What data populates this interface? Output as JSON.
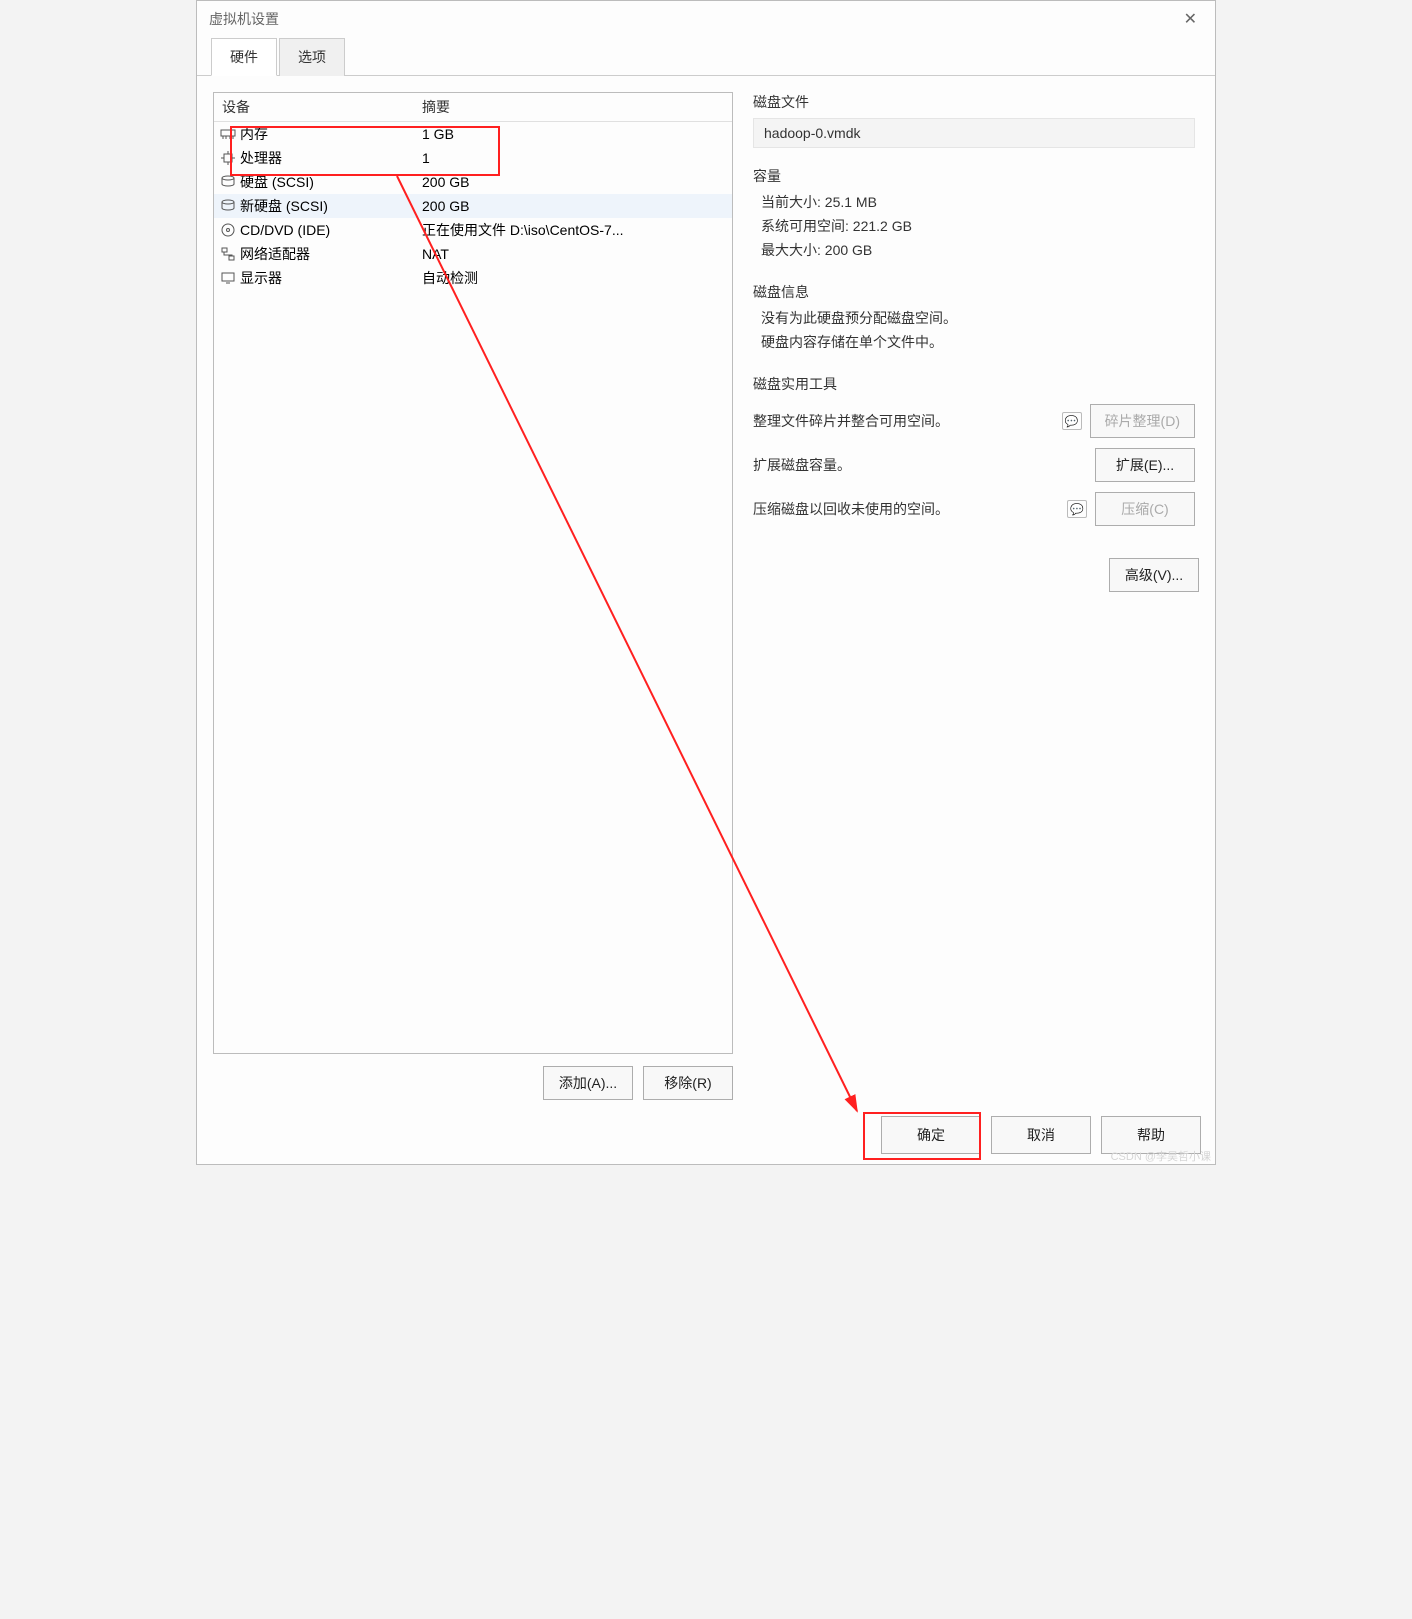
{
  "window": {
    "title": "虚拟机设置"
  },
  "tabs": {
    "hardware": "硬件",
    "options": "选项"
  },
  "device_table": {
    "header_device": "设备",
    "header_summary": "摘要",
    "rows": [
      {
        "icon": "memory",
        "name": "内存",
        "summary": "1 GB"
      },
      {
        "icon": "cpu",
        "name": "处理器",
        "summary": "1"
      },
      {
        "icon": "disk",
        "name": "硬盘 (SCSI)",
        "summary": "200 GB"
      },
      {
        "icon": "disk",
        "name": "新硬盘 (SCSI)",
        "summary": "200 GB"
      },
      {
        "icon": "cd",
        "name": "CD/DVD (IDE)",
        "summary": "正在使用文件 D:\\iso\\CentOS-7..."
      },
      {
        "icon": "net",
        "name": "网络适配器",
        "summary": "NAT"
      },
      {
        "icon": "display",
        "name": "显示器",
        "summary": "自动检测"
      }
    ]
  },
  "left_buttons": {
    "add": "添加(A)...",
    "remove": "移除(R)"
  },
  "right": {
    "disk_file_label": "磁盘文件",
    "disk_file_value": "hadoop-0.vmdk",
    "capacity_label": "容量",
    "current_size": "当前大小: 25.1 MB",
    "free_space": "系统可用空间: 221.2 GB",
    "max_size": "最大大小: 200 GB",
    "disk_info_label": "磁盘信息",
    "disk_info_line1": "没有为此硬盘预分配磁盘空间。",
    "disk_info_line2": "硬盘内容存储在单个文件中。",
    "tools_label": "磁盘实用工具",
    "defrag_desc": "整理文件碎片并整合可用空间。",
    "defrag_btn": "碎片整理(D)",
    "expand_desc": "扩展磁盘容量。",
    "expand_btn": "扩展(E)...",
    "compact_desc": "压缩磁盘以回收未使用的空间。",
    "compact_btn": "压缩(C)",
    "advanced_btn": "高级(V)..."
  },
  "footer": {
    "ok": "确定",
    "cancel": "取消",
    "help": "帮助"
  },
  "watermark": "CSDN @李昊哲小课"
}
